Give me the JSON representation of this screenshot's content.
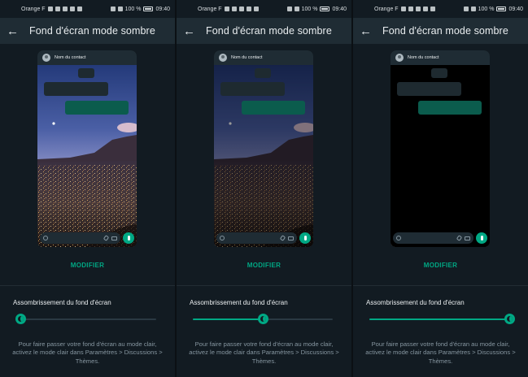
{
  "status_bar": {
    "carrier": "Orange F",
    "battery": "100 %",
    "time": "09:40"
  },
  "app_bar": {
    "title": "Fond d'écran mode sombre"
  },
  "preview": {
    "contact_name": "Nom du contact"
  },
  "modifier_label": "MODIFIER",
  "slider": {
    "label": "Assombrissement du fond d'écran"
  },
  "hint_text": "Pour faire passer votre fond d'écran au mode clair, activez le mode clair dans Paramètres > Discussions > Thèmes.",
  "icons": {
    "back": "arrow-back-icon",
    "avatar": "contact-avatar-icon",
    "emoji": "emoji-icon",
    "attach": "attach-icon",
    "camera": "camera-icon",
    "mic": "mic-icon",
    "thumb": "brightness-icon"
  },
  "colors": {
    "accent": "#00a884",
    "appbar": "#1f2c34",
    "background": "#121b22",
    "outgoing_bubble": "#0b5c4d",
    "incoming_bubble": "#1e2a30"
  },
  "panels": [
    {
      "dim_level": 0.0,
      "slider_value": 0.03
    },
    {
      "dim_level": 0.4,
      "slider_value": 0.5
    },
    {
      "dim_level": 1.0,
      "slider_value": 1.0
    }
  ]
}
